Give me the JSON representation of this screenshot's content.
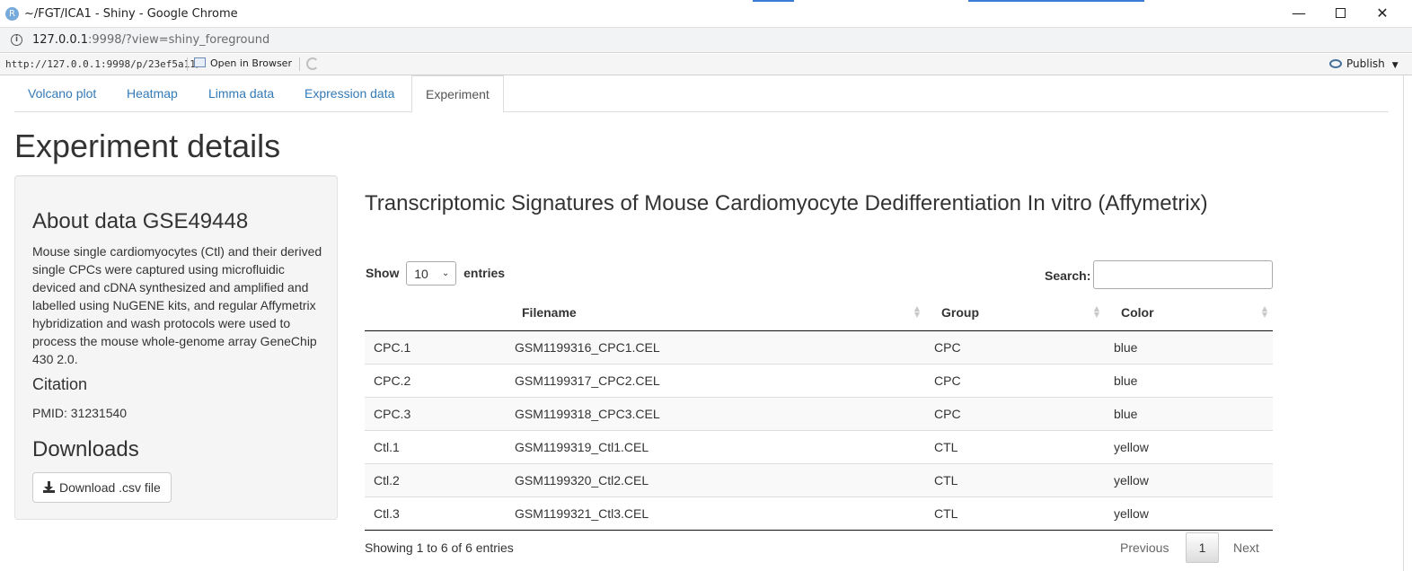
{
  "window": {
    "title": "~/FGT/ICA1 - Shiny - Google Chrome",
    "app_icon": "R",
    "minimize": "—",
    "close": "✕"
  },
  "address": {
    "host": "127.0.0.1",
    "rest": ":9998/?view=shiny_foreground"
  },
  "viewer": {
    "url": "http://127.0.0.1:9998/p/23ef5a11/",
    "open_in_browser": "Open in Browser",
    "publish": "Publish"
  },
  "tabs": [
    {
      "label": "Volcano plot",
      "active": false
    },
    {
      "label": "Heatmap",
      "active": false
    },
    {
      "label": "Limma data",
      "active": false
    },
    {
      "label": "Expression data",
      "active": false
    },
    {
      "label": "Experiment",
      "active": true
    }
  ],
  "page_title": "Experiment details",
  "sidebar": {
    "about_heading": "About data GSE49448",
    "about_text": "Mouse single cardiomyocytes (Ctl) and their derived single CPCs were captured using microfluidic deviced and cDNA synthesized and amplified and labelled using NuGENE kits, and regular Affymetrix hybridization and wash protocols were used to process the mouse whole-genome array GeneChip 430 2.0.",
    "citation_heading": "Citation",
    "pmid": "PMID: 31231540",
    "downloads_heading": "Downloads",
    "download_button": "Download .csv file"
  },
  "main": {
    "title": "Transcriptomic Signatures of Mouse Cardiomyocyte Dedifferentiation In vitro (Affymetrix)",
    "length_show": "Show",
    "length_value": "10",
    "length_entries": "entries",
    "search_label": "Search:",
    "search_value": "",
    "table": {
      "columns": [
        "",
        "Filename",
        "Group",
        "Color"
      ],
      "rows": [
        [
          "CPC.1",
          "GSM1199316_CPC1.CEL",
          "CPC",
          "blue"
        ],
        [
          "CPC.2",
          "GSM1199317_CPC2.CEL",
          "CPC",
          "blue"
        ],
        [
          "CPC.3",
          "GSM1199318_CPC3.CEL",
          "CPC",
          "blue"
        ],
        [
          "Ctl.1",
          "GSM1199319_Ctl1.CEL",
          "CTL",
          "yellow"
        ],
        [
          "Ctl.2",
          "GSM1199320_Ctl2.CEL",
          "CTL",
          "yellow"
        ],
        [
          "Ctl.3",
          "GSM1199321_Ctl3.CEL",
          "CTL",
          "yellow"
        ]
      ]
    },
    "info": "Showing 1 to 6 of 6 entries",
    "pagination": {
      "previous": "Previous",
      "current": "1",
      "next": "Next"
    }
  },
  "colors": {
    "link": "#337ab7",
    "well_bg": "#f5f5f5",
    "stripe_bg": "#f9f9f9"
  }
}
